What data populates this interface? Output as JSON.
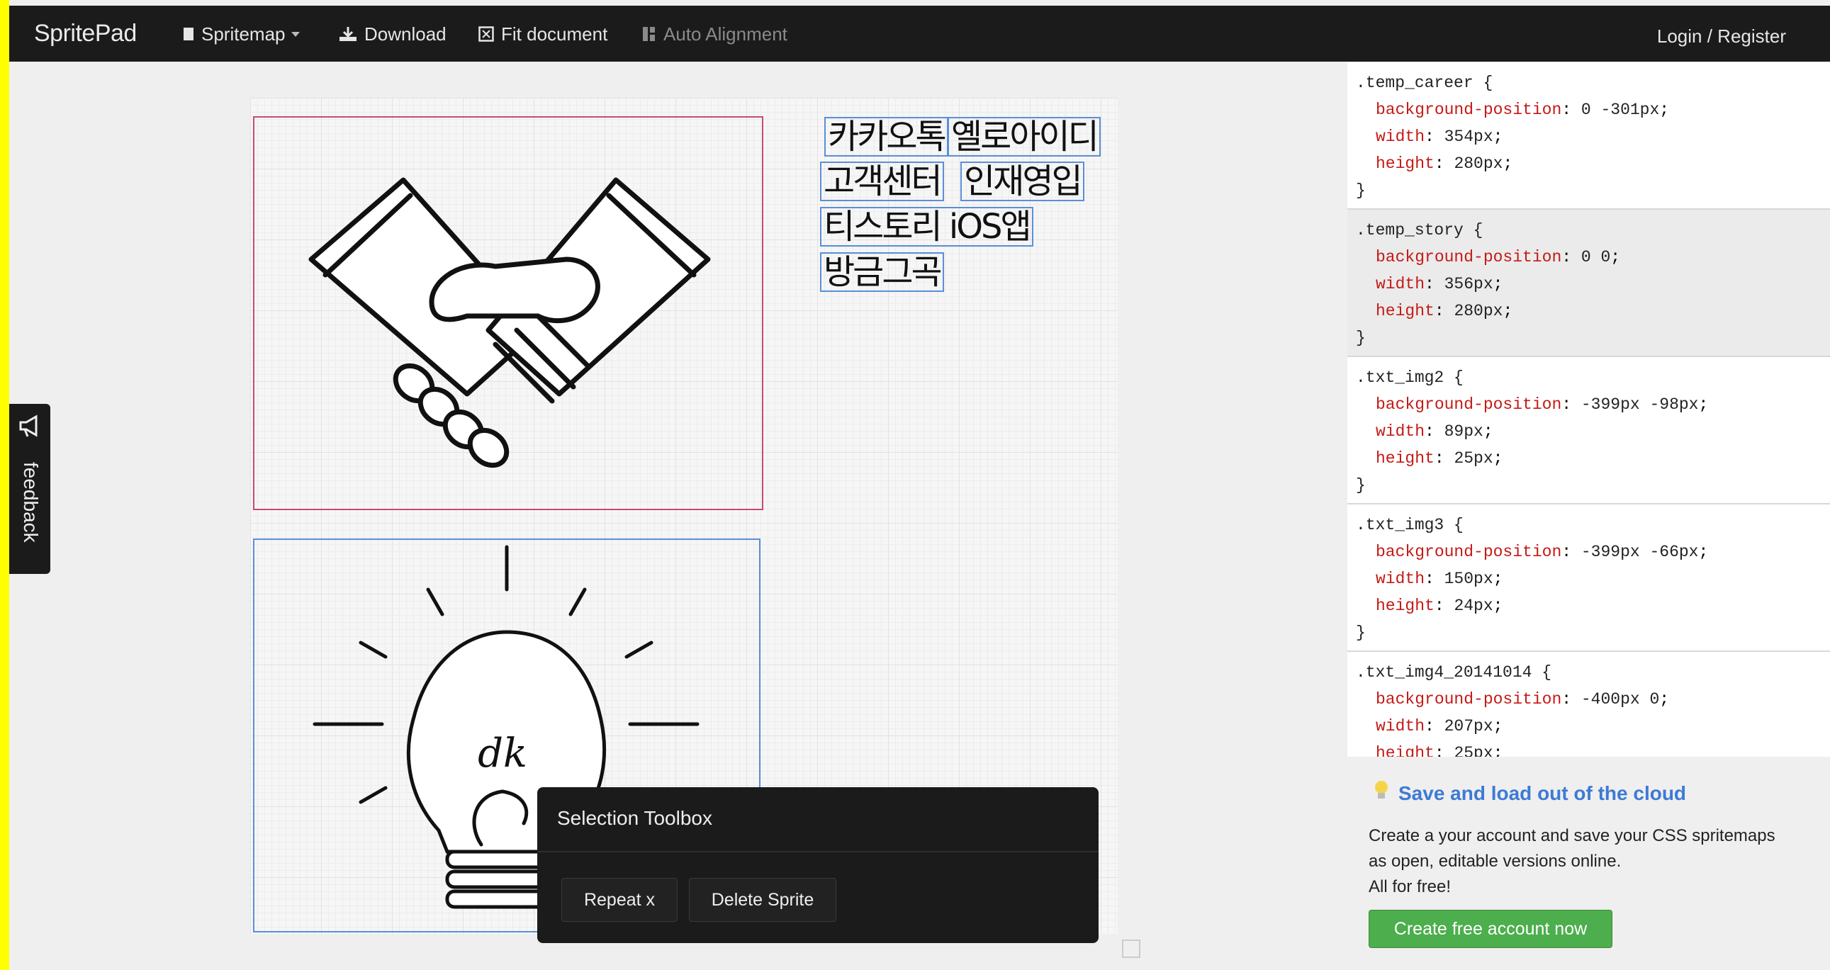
{
  "navbar": {
    "brand": "SpritePad",
    "items": [
      {
        "label": "Spritemap",
        "icon": "document-icon",
        "dropdown": true
      },
      {
        "label": "Download",
        "icon": "download-icon"
      },
      {
        "label": "Fit document",
        "icon": "fit-icon"
      },
      {
        "label": "Auto Alignment",
        "icon": "align-icon",
        "disabled": true
      }
    ],
    "login": "Login / Register"
  },
  "canvas": {
    "korean_labels": [
      "카카오톡",
      "옐로아이디",
      "고객센터",
      "인재영입",
      "티스토리 iOS앱",
      "방금그곡"
    ],
    "bulb_signature": "dk"
  },
  "feedback": {
    "label": "feedback",
    "icon": "megaphone-icon"
  },
  "css_rules": [
    {
      "selector": ".temp_career",
      "props": [
        {
          "k": "background-position",
          "v": "0 -301px"
        },
        {
          "k": "width",
          "v": "354px"
        },
        {
          "k": "height",
          "v": "280px"
        }
      ]
    },
    {
      "selector": ".temp_story",
      "props": [
        {
          "k": "background-position",
          "v": "0 0"
        },
        {
          "k": "width",
          "v": "356px"
        },
        {
          "k": "height",
          "v": "280px"
        }
      ]
    },
    {
      "selector": ".txt_img2",
      "props": [
        {
          "k": "background-position",
          "v": "-399px -98px"
        },
        {
          "k": "width",
          "v": "89px"
        },
        {
          "k": "height",
          "v": "25px"
        }
      ]
    },
    {
      "selector": ".txt_img3",
      "props": [
        {
          "k": "background-position",
          "v": "-399px -66px"
        },
        {
          "k": "width",
          "v": "150px"
        },
        {
          "k": "height",
          "v": "24px"
        }
      ]
    },
    {
      "selector": ".txt_img4_20141014",
      "props": [
        {
          "k": "background-position",
          "v": "-400px 0"
        },
        {
          "k": "width",
          "v": "207px"
        },
        {
          "k": "height",
          "v": "25px"
        }
      ]
    }
  ],
  "promo": {
    "title": "Save and load out of the cloud",
    "text_lines": [
      "Create a your account and save your CSS spritemaps",
      "as open, editable versions online.",
      "All for free!"
    ],
    "button": "Create free account now"
  },
  "toolbox": {
    "title": "Selection Toolbox",
    "repeat": "Repeat x",
    "delete": "Delete Sprite"
  },
  "colors": {
    "accent": "#3d7ad6",
    "success": "#4cae4c",
    "css_property": "#c41a16",
    "selection_pink": "#c8497a",
    "selection_blue": "#5b8fd8"
  }
}
